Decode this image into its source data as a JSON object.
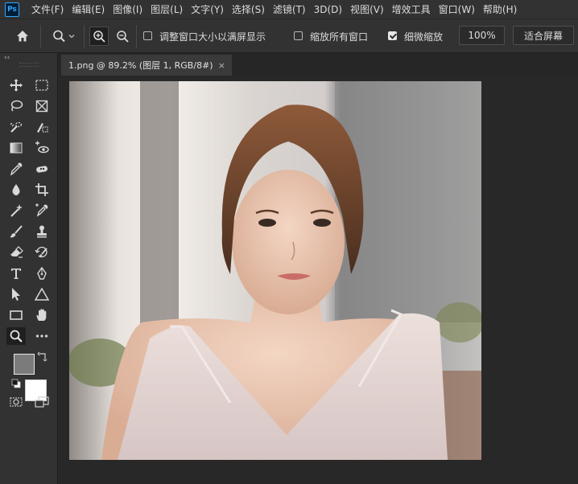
{
  "app": {
    "logo": "Ps"
  },
  "menubar": {
    "items": [
      "文件(F)",
      "编辑(E)",
      "图像(I)",
      "图层(L)",
      "文字(Y)",
      "选择(S)",
      "滤镜(T)",
      "3D(D)",
      "视图(V)",
      "增效工具",
      "窗口(W)",
      "帮助(H)"
    ]
  },
  "options": {
    "resize_windows_label": "调整窗口大小以满屏显示",
    "resize_windows_checked": false,
    "zoom_all_label": "缩放所有窗口",
    "zoom_all_checked": false,
    "scrubby_zoom_label": "细微缩放",
    "scrubby_zoom_checked": true,
    "zoom_percent": "100%",
    "fit_screen_label": "适合屏幕"
  },
  "document": {
    "tab_title": "1.png @ 89.2% (图层 1, RGB/8#)",
    "close_glyph": "×"
  },
  "colors": {
    "foreground": "#7b7b7b",
    "background": "#ffffff",
    "accent": "#31a8ff"
  },
  "tools": [
    "move-tool",
    "marquee-tool",
    "lasso-tool",
    "frame-tool",
    "quick-select-tool",
    "slice-tool",
    "gradient-tool",
    "red-eye-tool",
    "eyedropper-tool",
    "spot-heal-tool",
    "blur-tool",
    "crop-tool",
    "magic-eraser-tool",
    "color-sampler-tool",
    "brush-tool",
    "stamp-tool",
    "eraser-tool",
    "history-brush-tool",
    "type-tool",
    "pen-tool",
    "path-select-tool",
    "triangle-tool",
    "rectangle-tool",
    "hand-tool",
    "zoom-tool",
    "more-tools"
  ]
}
